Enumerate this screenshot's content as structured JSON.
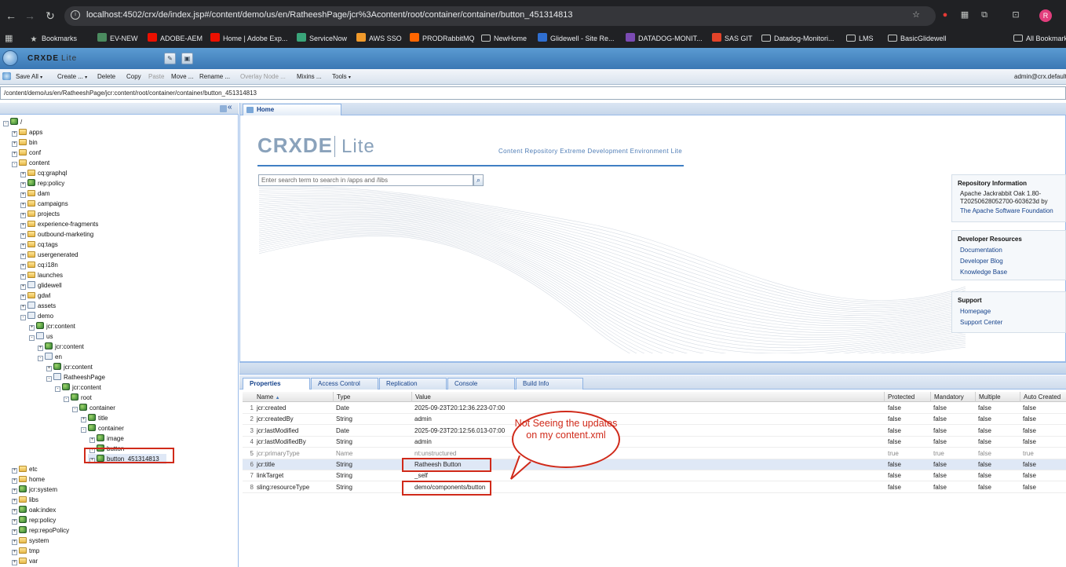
{
  "browser": {
    "url": "localhost:4502/crx/de/index.jsp#/content/demo/us/en/RatheeshPage/jcr%3Acontent/root/container/container/button_451314813",
    "profile_initial": "R",
    "bookmarks": [
      {
        "label": "Bookmarks",
        "icon": "star-icon"
      },
      {
        "label": "EV-NEW",
        "icon": "ev-icon"
      },
      {
        "label": "ADOBE-AEM",
        "icon": "adobe-icon"
      },
      {
        "label": "Home | Adobe Exp...",
        "icon": "adobe-icon"
      },
      {
        "label": "ServiceNow",
        "icon": "servicenow-icon"
      },
      {
        "label": "AWS SSO",
        "icon": "aws-icon"
      },
      {
        "label": "PRODRabbitMQ",
        "icon": "rabbitmq-icon"
      },
      {
        "label": "NewHome",
        "icon": "folder-icon"
      },
      {
        "label": "Glidewell - Site Re...",
        "icon": "glidewell-icon"
      },
      {
        "label": "DATADOG-MONIT...",
        "icon": "datadog-icon"
      },
      {
        "label": "SAS GIT",
        "icon": "gitlab-icon"
      },
      {
        "label": "Datadog-Monitori...",
        "icon": "folder-icon"
      },
      {
        "label": "LMS",
        "icon": "folder-icon"
      },
      {
        "label": "BasicGlidewell",
        "icon": "folder-icon"
      },
      {
        "label": "All Bookmarks",
        "icon": "folder-icon"
      }
    ]
  },
  "app": {
    "title": "CRXDE",
    "title_suffix": "Lite",
    "user": "admin@crx.default",
    "path": "/content/demo/us/en/RatheeshPage/jcr:content/root/container/container/button_451314813"
  },
  "toolbar": {
    "save_all": "Save All",
    "create": "Create ...",
    "delete": "Delete",
    "copy": "Copy",
    "paste": "Paste",
    "move": "Move ...",
    "rename": "Rename ...",
    "overlay": "Overlay Node ...",
    "mixins": "Mixins ...",
    "tools": "Tools"
  },
  "tree": [
    {
      "label": "/",
      "icon": "node",
      "ex": "-"
    },
    {
      "label": "apps",
      "icon": "folder",
      "ex": "+"
    },
    {
      "label": "bin",
      "icon": "folder",
      "ex": "+"
    },
    {
      "label": "conf",
      "icon": "folder",
      "ex": "+"
    },
    {
      "label": "content",
      "icon": "folder",
      "ex": "-"
    },
    {
      "label": "cq:graphql",
      "icon": "folder",
      "ex": "+"
    },
    {
      "label": "rep:policy",
      "icon": "node",
      "ex": "+"
    },
    {
      "label": "dam",
      "icon": "folder",
      "ex": "+"
    },
    {
      "label": "campaigns",
      "icon": "folder",
      "ex": "+"
    },
    {
      "label": "projects",
      "icon": "folder",
      "ex": "+"
    },
    {
      "label": "experience-fragments",
      "icon": "folder",
      "ex": "+"
    },
    {
      "label": "outbound-marketing",
      "icon": "folder",
      "ex": "+"
    },
    {
      "label": "cq:tags",
      "icon": "folder",
      "ex": "+"
    },
    {
      "label": "usergenerated",
      "icon": "folder",
      "ex": "+"
    },
    {
      "label": "cq:i18n",
      "icon": "folder",
      "ex": "+"
    },
    {
      "label": "launches",
      "icon": "folder",
      "ex": "+"
    },
    {
      "label": "glidewell",
      "icon": "page",
      "ex": "+"
    },
    {
      "label": "gdwl",
      "icon": "folder",
      "ex": "+"
    },
    {
      "label": "assets",
      "icon": "page",
      "ex": "+"
    },
    {
      "label": "demo",
      "icon": "page",
      "ex": "-"
    },
    {
      "label": "jcr:content",
      "icon": "node",
      "ex": "+"
    },
    {
      "label": "us",
      "icon": "page",
      "ex": "-"
    },
    {
      "label": "jcr:content",
      "icon": "node",
      "ex": "+"
    },
    {
      "label": "en",
      "icon": "page",
      "ex": "-"
    },
    {
      "label": "jcr:content",
      "icon": "node",
      "ex": "+"
    },
    {
      "label": "RatheeshPage",
      "icon": "page",
      "ex": "-"
    },
    {
      "label": "jcr:content",
      "icon": "node",
      "ex": "-"
    },
    {
      "label": "root",
      "icon": "node",
      "ex": "-"
    },
    {
      "label": "container",
      "icon": "node",
      "ex": "-"
    },
    {
      "label": "title",
      "icon": "node",
      "ex": "+"
    },
    {
      "label": "container",
      "icon": "node",
      "ex": "-"
    },
    {
      "label": "image",
      "icon": "node",
      "ex": "+"
    },
    {
      "label": "button",
      "icon": "node",
      "ex": "+"
    },
    {
      "label": "button_451314813",
      "icon": "node",
      "ex": "+"
    },
    {
      "label": "etc",
      "icon": "folder",
      "ex": "+"
    },
    {
      "label": "home",
      "icon": "folder",
      "ex": "+"
    },
    {
      "label": "jcr:system",
      "icon": "node",
      "ex": "+"
    },
    {
      "label": "libs",
      "icon": "folder",
      "ex": "+"
    },
    {
      "label": "oak:index",
      "icon": "node",
      "ex": "+"
    },
    {
      "label": "rep:policy",
      "icon": "node",
      "ex": "+"
    },
    {
      "label": "rep:repoPolicy",
      "icon": "node",
      "ex": "+"
    },
    {
      "label": "system",
      "icon": "folder",
      "ex": "+"
    },
    {
      "label": "tmp",
      "icon": "folder",
      "ex": "+"
    },
    {
      "label": "var",
      "icon": "folder",
      "ex": "+"
    }
  ],
  "home": {
    "tab": "Home",
    "logo": "CRXDE",
    "logo_suffix": "Lite",
    "subtitle": "Content Repository Extreme Development Environment Lite",
    "search_placeholder": "Enter search term to search in /apps and /libs",
    "repo": {
      "title": "Repository Information",
      "line1": "Apache Jackrabbit Oak 1.80-",
      "line2": "T20250628052700-603623d by",
      "link": "The Apache Software Foundation"
    },
    "dev": {
      "title": "Developer Resources",
      "links": [
        "Documentation",
        "Developer Blog",
        "Knowledge Base"
      ]
    },
    "support": {
      "title": "Support",
      "links": [
        "Homepage",
        "Support Center"
      ]
    }
  },
  "bottom_tabs": [
    "Properties",
    "Access Control",
    "Replication",
    "Console",
    "Build Info"
  ],
  "columns": [
    "Name",
    "Type",
    "Value",
    "Protected",
    "Mandatory",
    "Multiple",
    "Auto Created"
  ],
  "properties": [
    {
      "n": "1",
      "name": "jcr:created",
      "type": "Date",
      "value": "2025-09-23T20:12:36.223-07:00",
      "prot": "false",
      "mand": "false",
      "mult": "false",
      "auto": "false"
    },
    {
      "n": "2",
      "name": "jcr:createdBy",
      "type": "String",
      "value": "admin",
      "prot": "false",
      "mand": "false",
      "mult": "false",
      "auto": "false"
    },
    {
      "n": "3",
      "name": "jcr:lastModified",
      "type": "Date",
      "value": "2025-09-23T20:12:56.013-07:00",
      "prot": "false",
      "mand": "false",
      "mult": "false",
      "auto": "false"
    },
    {
      "n": "4",
      "name": "jcr:lastModifiedBy",
      "type": "String",
      "value": "admin",
      "prot": "false",
      "mand": "false",
      "mult": "false",
      "auto": "false"
    },
    {
      "n": "5",
      "name": "jcr:primaryType",
      "type": "Name",
      "value": "nt:unstructured",
      "prot": "true",
      "mand": "true",
      "mult": "false",
      "auto": "true"
    },
    {
      "n": "6",
      "name": "jcr:title",
      "type": "String",
      "value": "Ratheesh Button",
      "prot": "false",
      "mand": "false",
      "mult": "false",
      "auto": "false"
    },
    {
      "n": "7",
      "name": "linkTarget",
      "type": "String",
      "value": "_self",
      "prot": "false",
      "mand": "false",
      "mult": "false",
      "auto": "false"
    },
    {
      "n": "8",
      "name": "sling:resourceType",
      "type": "String",
      "value": "demo/components/button",
      "prot": "false",
      "mand": "false",
      "mult": "false",
      "auto": "false"
    }
  ],
  "callout": "Not Seeing the updates on my content.xml",
  "colors": {
    "accent": "#3f7fc4",
    "annotation": "#d02a1a"
  }
}
